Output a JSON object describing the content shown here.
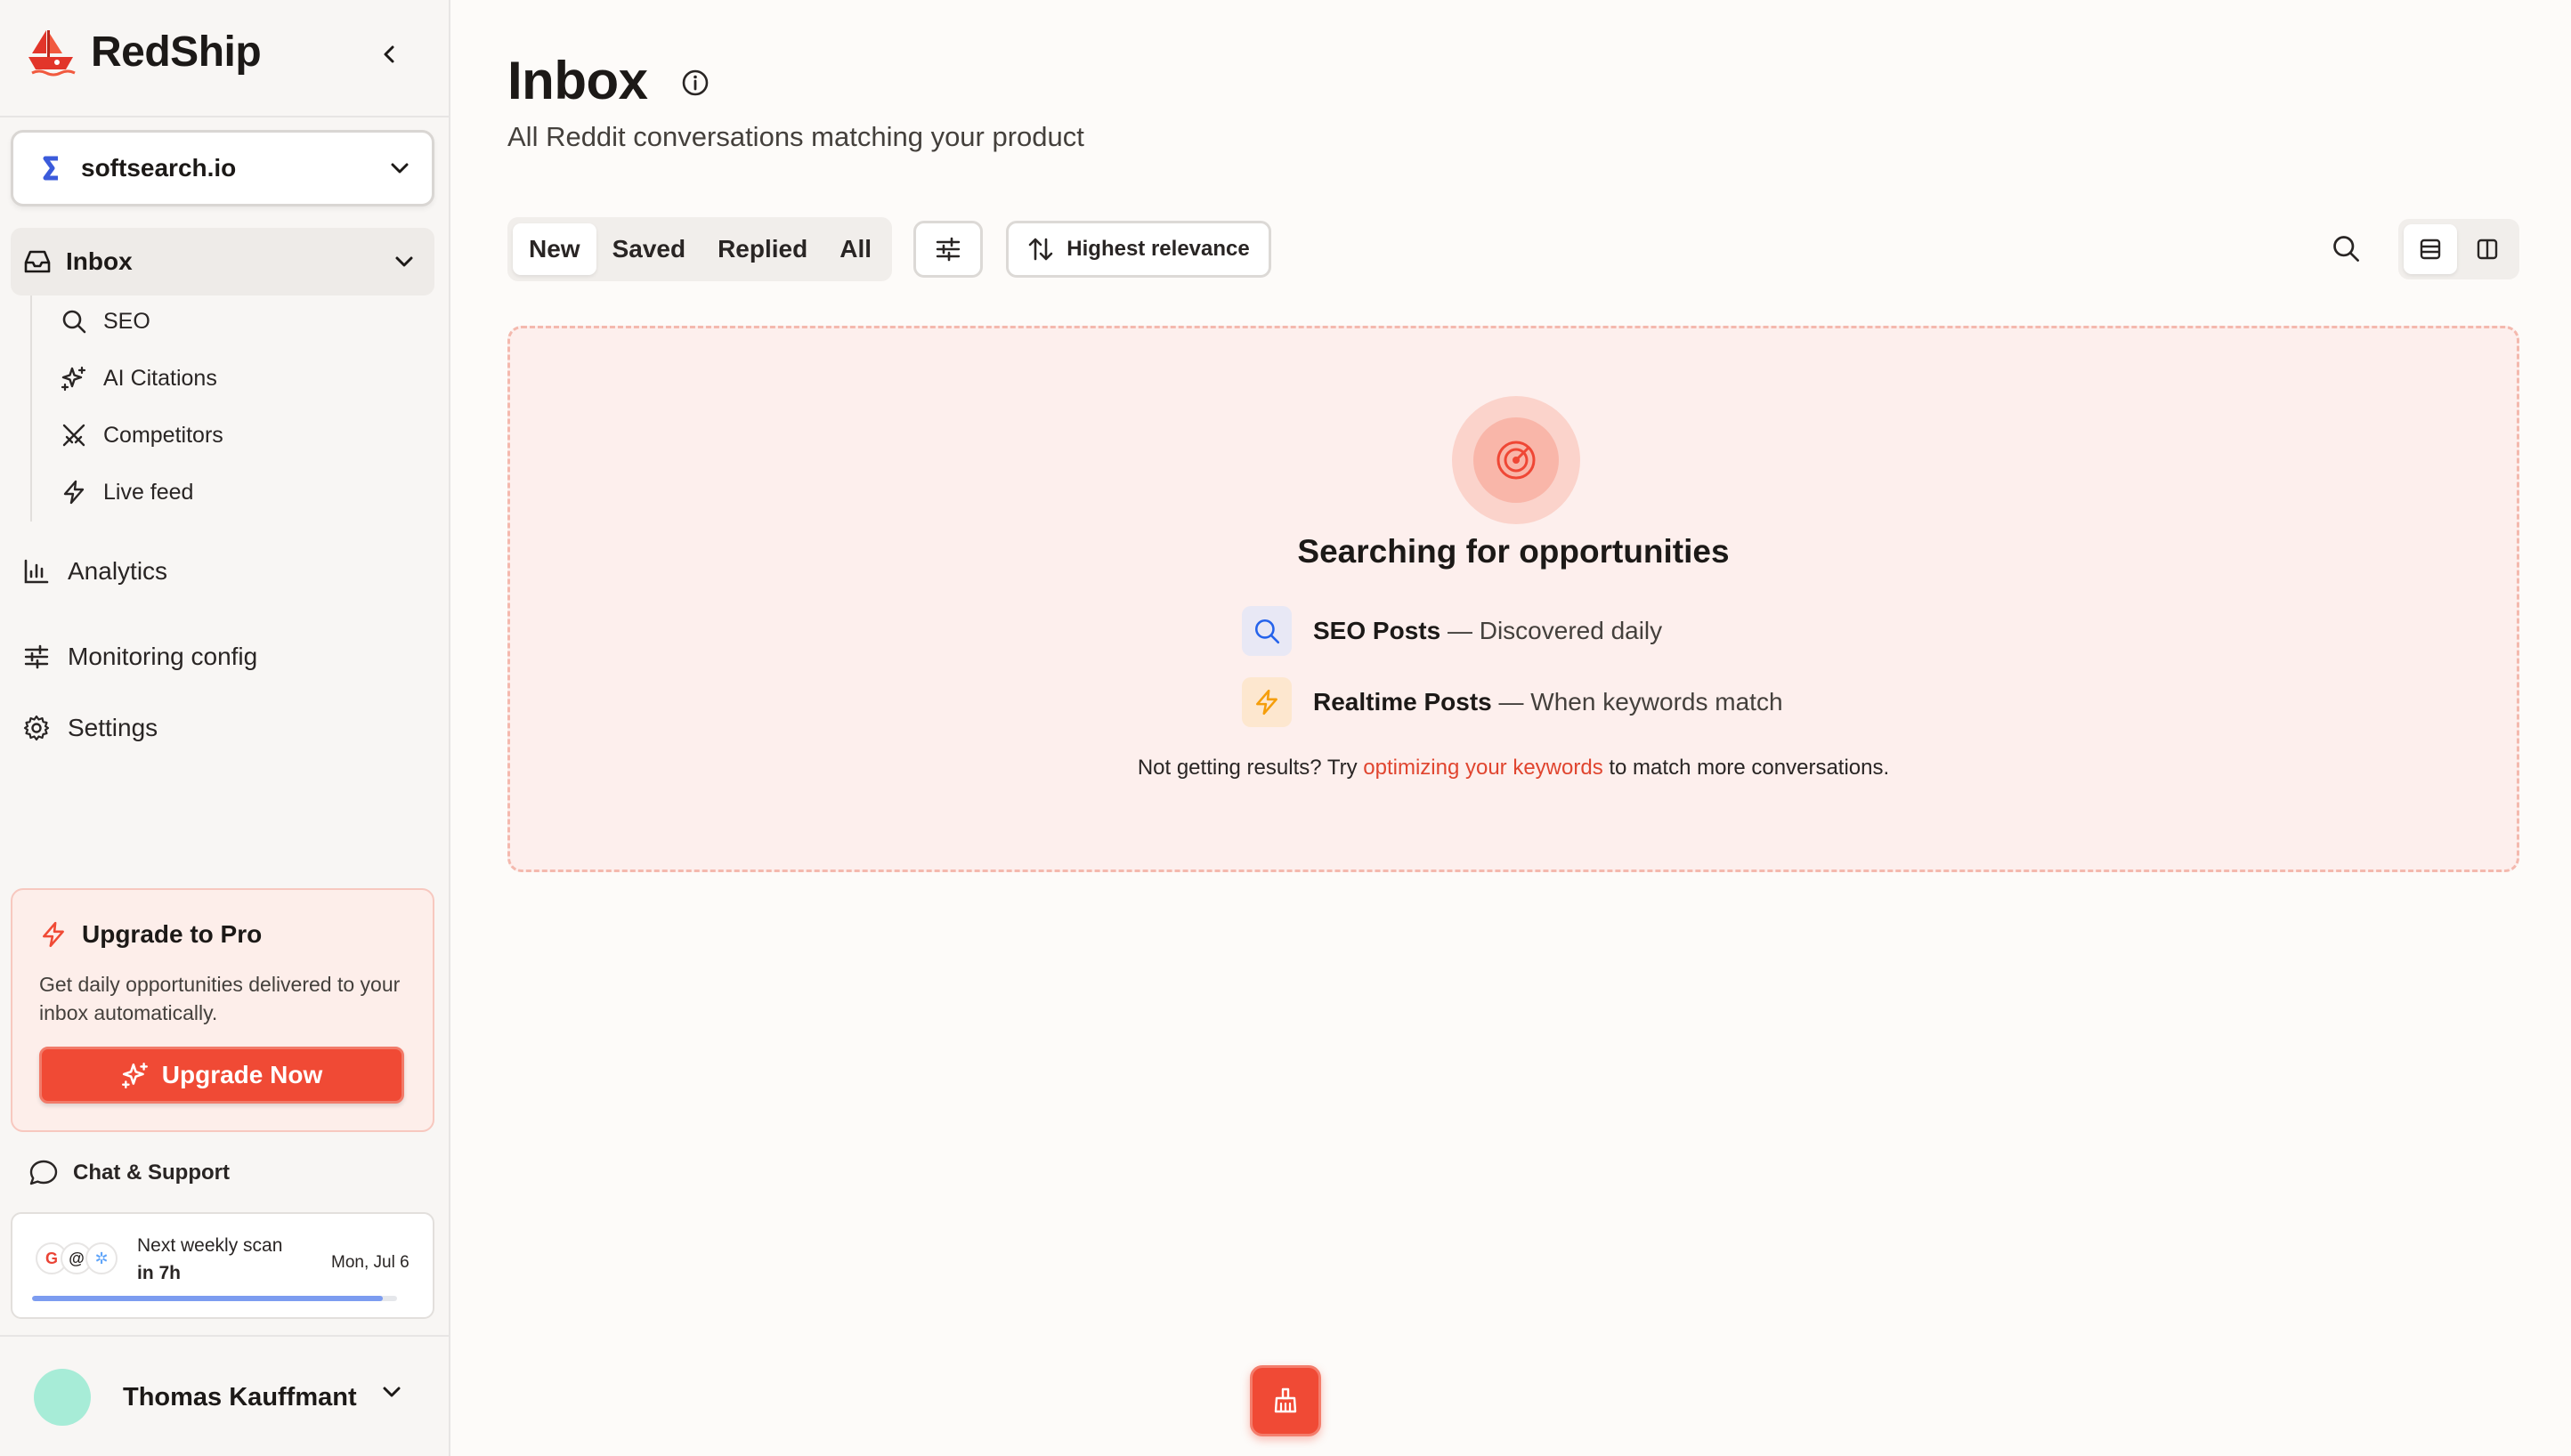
{
  "brand": {
    "name": "RedShip",
    "logo_icon": "ship-logo-icon"
  },
  "sidebar": {
    "project": {
      "name": "softsearch.io"
    },
    "inbox": {
      "label": "Inbox"
    },
    "inbox_items": [
      {
        "label": "SEO",
        "icon": "search-icon"
      },
      {
        "label": "AI Citations",
        "icon": "sparkles-icon"
      },
      {
        "label": "Competitors",
        "icon": "crossed-swords-icon"
      },
      {
        "label": "Live feed",
        "icon": "bolt-icon"
      }
    ],
    "nav": [
      {
        "label": "Analytics",
        "icon": "bar-chart-icon"
      },
      {
        "label": "Monitoring config",
        "icon": "sliders-icon"
      },
      {
        "label": "Settings",
        "icon": "gear-icon"
      }
    ],
    "upgrade": {
      "title": "Upgrade to Pro",
      "text": "Get daily opportunities delivered to your inbox automatically.",
      "button": "Upgrade Now"
    },
    "chat_support": "Chat & Support",
    "scan": {
      "label": "Next weekly scan",
      "when": "in 7h",
      "date": "Mon, Jul 6",
      "progress": 0.96
    },
    "user": {
      "name": "Thomas Kauffmant"
    }
  },
  "main": {
    "title": "Inbox",
    "subtitle": "All Reddit conversations matching your product",
    "tabs": [
      "New",
      "Saved",
      "Replied",
      "All"
    ],
    "active_tab": "New",
    "sort_label": "Highest relevance",
    "empty": {
      "title": "Searching for opportunities",
      "features": [
        {
          "title": "SEO Posts",
          "desc": " — Discovered daily"
        },
        {
          "title": "Realtime Posts",
          "desc": " — When keywords match"
        }
      ],
      "hint_before": "Not getting results? Try ",
      "hint_link": "optimizing your keywords",
      "hint_after": " to match more conversations."
    }
  },
  "colors": {
    "accent": "#f04a35",
    "link": "#e0452f",
    "scan_progress": "#7c9cf0",
    "avatar": "#a7ecd7"
  }
}
